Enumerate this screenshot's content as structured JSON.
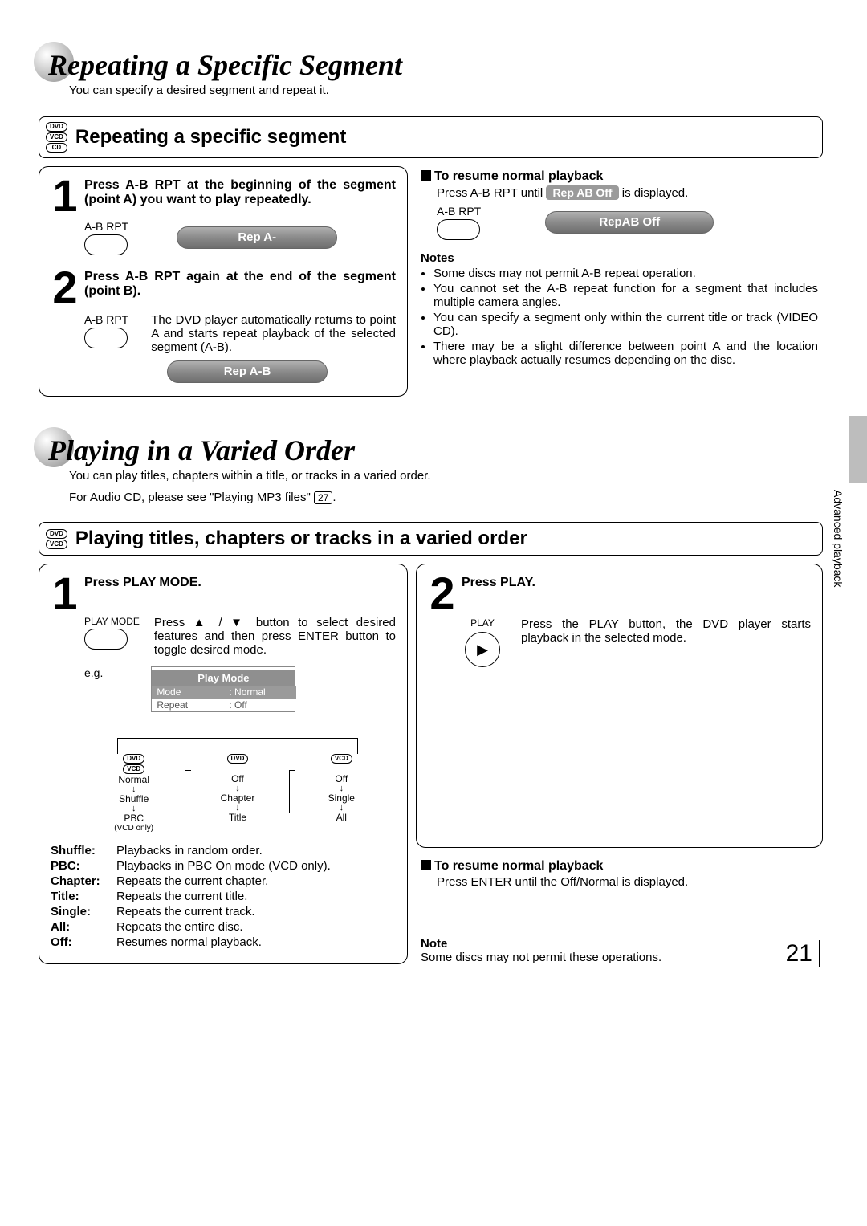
{
  "side": {
    "section_label": "Advanced playback"
  },
  "page_number": "21",
  "sec1": {
    "title": "Repeating a Specific Segment",
    "sub": "You can specify a desired segment and repeat it.",
    "bar_title": "Repeating a specific segment",
    "discs": [
      "DVD",
      "VCD",
      "CD"
    ],
    "step1": {
      "num": "1",
      "text": "Press A-B RPT at the beginning of the segment (point A) you want to play repeatedly.",
      "btn": "A-B RPT",
      "osd": "Rep A-"
    },
    "step2": {
      "num": "2",
      "text": "Press A-B RPT again at the end of the segment (point B).",
      "btn": "A-B RPT",
      "body": "The DVD player automatically returns to point A and starts repeat playback of the selected segment (A-B).",
      "osd": "Rep A-B"
    },
    "resume": {
      "heading": "To resume normal playback",
      "line_pre": "Press A-B RPT until ",
      "chip": "Rep AB Off",
      "line_post": " is displayed.",
      "btn": "A-B RPT",
      "osd": "RepAB Off"
    },
    "notes_label": "Notes",
    "notes": [
      "Some discs may not permit A-B repeat operation.",
      "You cannot set the A-B repeat function for a segment that includes multiple camera angles.",
      "You can specify a segment only within the current title or track (VIDEO CD).",
      "There may be a slight difference between point A and the location where playback actually resumes depending on the disc."
    ]
  },
  "sec2": {
    "title": "Playing in a Varied Order",
    "sub1": "You can play titles, chapters within a title, or tracks in a varied order.",
    "sub2_pre": "For Audio CD, please see \"Playing MP3 files\" ",
    "sub2_ref": "27",
    "sub2_post": ".",
    "bar_title": "Playing titles, chapters or tracks in a varied order",
    "discs": [
      "DVD",
      "VCD"
    ],
    "step1": {
      "num": "1",
      "text": "Press PLAY MODE.",
      "btn": "PLAY MODE",
      "body": "Press ▲ / ▼ button to select desired features and then press ENTER button to toggle desired mode.",
      "eg": "e.g.",
      "panel_title": "Play Mode",
      "panel_mode_k": "Mode",
      "panel_mode_v": ": Normal",
      "panel_rep_k": "Repeat",
      "panel_rep_v": ": Off",
      "tree": {
        "col1_tag": "DVD",
        "col1_sub": "VCD",
        "c1": [
          "Normal",
          "Shuffle",
          "PBC",
          "(VCD only)"
        ],
        "col2_tag": "DVD",
        "c2": [
          "Off",
          "Chapter",
          "Title"
        ],
        "col3_tag": "VCD",
        "c3": [
          "Off",
          "Single",
          "All"
        ]
      },
      "defs": [
        {
          "k": "Shuffle:",
          "v": "Playbacks in random order."
        },
        {
          "k": "PBC:",
          "v": "Playbacks in PBC On mode (VCD only)."
        },
        {
          "k": "Chapter:",
          "v": "Repeats the current chapter."
        },
        {
          "k": "Title:",
          "v": "Repeats the current title."
        },
        {
          "k": "Single:",
          "v": "Repeats the current track."
        },
        {
          "k": "All:",
          "v": "Repeats the entire disc."
        },
        {
          "k": "Off:",
          "v": "Resumes normal playback."
        }
      ]
    },
    "step2": {
      "num": "2",
      "text": "Press PLAY.",
      "btn": "PLAY",
      "body": "Press the PLAY button, the DVD player starts playback in the selected mode."
    },
    "resume": {
      "heading": "To resume normal playback",
      "line": "Press ENTER until the Off/Normal is displayed."
    },
    "note_label": "Note",
    "note": "Some discs may not permit these operations."
  }
}
